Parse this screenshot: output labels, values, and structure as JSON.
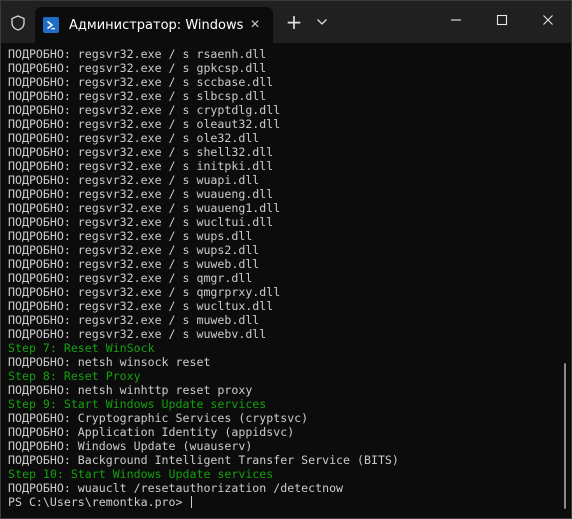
{
  "window": {
    "tab_title": "Администратор: Windows PowerShell",
    "new_tab_glyph": "+",
    "close_tab_glyph": "×"
  },
  "colors": {
    "titlebar": "#202020",
    "terminal_bg": "#0c0c0c",
    "text": "#cccccc",
    "step": "#13a10e",
    "powershell_icon": "#1e6ec8"
  },
  "icons": [
    "shield-icon",
    "powershell-icon",
    "close-icon",
    "plus-icon",
    "chevron-down-icon",
    "minimize-icon",
    "maximize-icon",
    "close-window-icon"
  ],
  "terminal": {
    "lines": [
      {
        "text": "ПОДРОБНО: regsvr32.exe / s rsaenh.dll",
        "kind": "normal"
      },
      {
        "text": "ПОДРОБНО: regsvr32.exe / s gpkcsp.dll",
        "kind": "normal"
      },
      {
        "text": "ПОДРОБНО: regsvr32.exe / s sccbase.dll",
        "kind": "normal"
      },
      {
        "text": "ПОДРОБНО: regsvr32.exe / s slbcsp.dll",
        "kind": "normal"
      },
      {
        "text": "ПОДРОБНО: regsvr32.exe / s cryptdlg.dll",
        "kind": "normal"
      },
      {
        "text": "ПОДРОБНО: regsvr32.exe / s oleaut32.dll",
        "kind": "normal"
      },
      {
        "text": "ПОДРОБНО: regsvr32.exe / s ole32.dll",
        "kind": "normal"
      },
      {
        "text": "ПОДРОБНО: regsvr32.exe / s shell32.dll",
        "kind": "normal"
      },
      {
        "text": "ПОДРОБНО: regsvr32.exe / s initpki.dll",
        "kind": "normal"
      },
      {
        "text": "ПОДРОБНО: regsvr32.exe / s wuapi.dll",
        "kind": "normal"
      },
      {
        "text": "ПОДРОБНО: regsvr32.exe / s wuaueng.dll",
        "kind": "normal"
      },
      {
        "text": "ПОДРОБНО: regsvr32.exe / s wuaueng1.dll",
        "kind": "normal"
      },
      {
        "text": "ПОДРОБНО: regsvr32.exe / s wucltui.dll",
        "kind": "normal"
      },
      {
        "text": "ПОДРОБНО: regsvr32.exe / s wups.dll",
        "kind": "normal"
      },
      {
        "text": "ПОДРОБНО: regsvr32.exe / s wups2.dll",
        "kind": "normal"
      },
      {
        "text": "ПОДРОБНО: regsvr32.exe / s wuweb.dll",
        "kind": "normal"
      },
      {
        "text": "ПОДРОБНО: regsvr32.exe / s qmgr.dll",
        "kind": "normal"
      },
      {
        "text": "ПОДРОБНО: regsvr32.exe / s qmgrprxy.dll",
        "kind": "normal"
      },
      {
        "text": "ПОДРОБНО: regsvr32.exe / s wucltux.dll",
        "kind": "normal"
      },
      {
        "text": "ПОДРОБНО: regsvr32.exe / s muweb.dll",
        "kind": "normal"
      },
      {
        "text": "ПОДРОБНО: regsvr32.exe / s wuwebv.dll",
        "kind": "normal"
      },
      {
        "text": "Step 7: Reset WinSock",
        "kind": "step"
      },
      {
        "text": "ПОДРОБНО: netsh winsock reset",
        "kind": "normal"
      },
      {
        "text": "Step 8: Reset Proxy",
        "kind": "step"
      },
      {
        "text": "ПОДРОБНО: netsh winhttp reset proxy",
        "kind": "normal"
      },
      {
        "text": "Step 9: Start Windows Update services",
        "kind": "step"
      },
      {
        "text": "ПОДРОБНО: Cryptographic Services (cryptsvc)",
        "kind": "normal"
      },
      {
        "text": "ПОДРОБНО: Application Identity (appidsvc)",
        "kind": "normal"
      },
      {
        "text": "ПОДРОБНО: Windows Update (wuauserv)",
        "kind": "normal"
      },
      {
        "text": "ПОДРОБНО: Background Intelligent Transfer Service (BITS)",
        "kind": "normal"
      },
      {
        "text": "Step 10: Start Windows Update services",
        "kind": "step"
      },
      {
        "text": "ПОДРОБНО: wuauclt /resetauthorization /detectnow",
        "kind": "normal"
      }
    ],
    "prompt": "PS C:\\Users\\remontka.pro> "
  }
}
